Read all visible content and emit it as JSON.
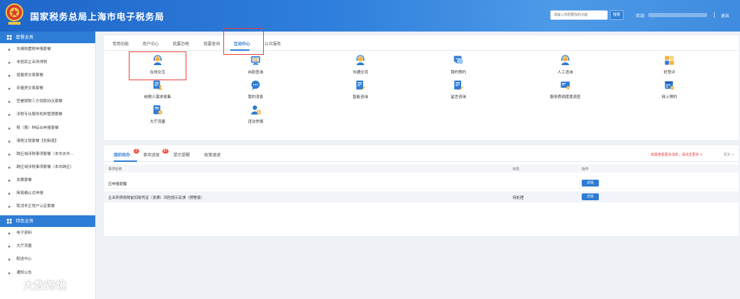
{
  "header": {
    "title": "国家税务总局上海市电子税务局",
    "search_placeholder": "请输入你想要找的功能",
    "search_button": "搜索",
    "welcome": "欢迎:",
    "logout": "退出",
    "colors": {
      "header_start": "#1f66c9",
      "header_end": "#4d9ae8"
    }
  },
  "sidebar": {
    "sections": [
      {
        "title": "套餐业务",
        "items": [
          "车辆购置税申报套餐",
          "非居民企业所得税",
          "增量房交易套餐",
          "存量房交易套餐",
          "签署银税三方划款协议套餐",
          "涉税专业服务机构管理套餐",
          "税（费）种综合申报套餐",
          "清税注销套餐【创新版】",
          "跨区域涉税事项套餐（本市去外…",
          "跨区域涉税事项套餐（本市跨区）",
          "发票套餐",
          "简易确认式申报",
          "取消非正常户认定套餐"
        ]
      },
      {
        "title": "特色业务",
        "items": [
          "电子资料",
          "大厅流量",
          "配送中心",
          "通知公告"
        ]
      }
    ]
  },
  "main": {
    "tabs": [
      "常用功能",
      "用户中心",
      "我要办税",
      "我要查询",
      "互动中心",
      "公众服务"
    ],
    "active_tab": "互动中心",
    "functions": [
      {
        "label": "在线交互",
        "icon": "service-agent-icon"
      },
      {
        "label": "自助查询",
        "icon": "monitor-search-icon"
      },
      {
        "label": "沟通交流",
        "icon": "service-agent-icon"
      },
      {
        "label": "我的预约",
        "icon": "chat-bubble-icon"
      },
      {
        "label": "人工咨询",
        "icon": "service-agent-icon"
      },
      {
        "label": "好差评",
        "icon": "rating-icon"
      },
      {
        "label": "纳税人需求收集",
        "icon": "document-user-icon"
      },
      {
        "label": "我的消息",
        "icon": "message-icon"
      },
      {
        "label": "智能咨询",
        "icon": "document-edit-icon"
      },
      {
        "label": "留言咨询",
        "icon": "document-edit-icon"
      },
      {
        "label": "服务质调度度调查",
        "icon": "survey-card-icon"
      },
      {
        "label": "网上预约",
        "icon": "calendar-clock-icon"
      },
      {
        "label": "大厅流量",
        "icon": "document-clock-icon"
      },
      {
        "label": "违法举报",
        "icon": "report-user-icon"
      }
    ]
  },
  "tasks": {
    "tabs": [
      {
        "label": "我的待办",
        "badge": "2"
      },
      {
        "label": "事项进度",
        "badge": "87"
      },
      {
        "label": "提示提醒",
        "badge": ""
      },
      {
        "label": "政策速递",
        "badge": ""
      }
    ],
    "notice": "如需查看更多消息，请点击更多 >",
    "more": "更多 >",
    "columns": [
      "事项名称",
      "状态",
      "操作"
    ],
    "rows": [
      {
        "name": "应申报提醒",
        "status": "",
        "action": "详情"
      },
      {
        "name": "企业所得税税前扣除凭证（发票）风险提示反馈（预警版）",
        "status": "待处理",
        "action": "详情"
      }
    ]
  },
  "watermark": {
    "text": "大数跨境"
  }
}
